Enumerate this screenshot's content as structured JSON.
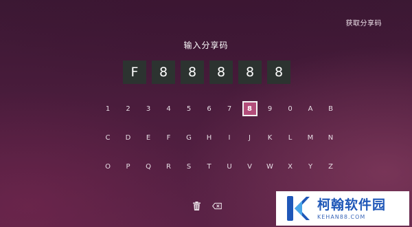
{
  "top": {
    "get_code_label": "获取分享码"
  },
  "title": "输入分享码",
  "code_boxes": [
    "F",
    "8",
    "8",
    "8",
    "8",
    "8"
  ],
  "keyboard": {
    "rows": [
      [
        "1",
        "2",
        "3",
        "4",
        "5",
        "6",
        "7",
        "8",
        "9",
        "0",
        "A",
        "B"
      ],
      [
        "C",
        "D",
        "E",
        "F",
        "G",
        "H",
        "I",
        "J",
        "K",
        "L",
        "M",
        "N"
      ],
      [
        "O",
        "P",
        "Q",
        "R",
        "S",
        "T",
        "U",
        "V",
        "W",
        "X",
        "Y",
        "Z"
      ]
    ],
    "selected_key": "8"
  },
  "actions": {
    "delete_all_icon": "trash-icon",
    "backspace_icon": "backspace-icon"
  },
  "watermark": {
    "name": "柯翰软件园",
    "url": "KEHAN88.COM",
    "brand_color": "#1f57b8"
  },
  "colors": {
    "selected_key_bg": "#b24d7a",
    "code_box_bg": "#2c3330"
  }
}
